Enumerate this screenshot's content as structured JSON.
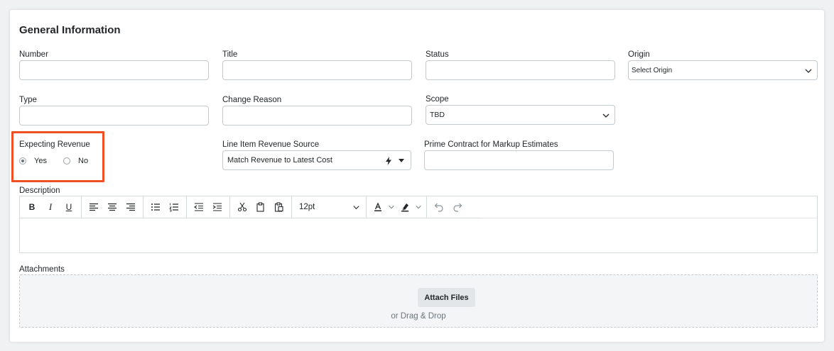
{
  "section": {
    "title": "General Information"
  },
  "fields": {
    "number": {
      "label": "Number",
      "value": ""
    },
    "title": {
      "label": "Title",
      "value": ""
    },
    "status": {
      "label": "Status",
      "value": ""
    },
    "origin": {
      "label": "Origin",
      "value": "Select Origin"
    },
    "type": {
      "label": "Type",
      "value": ""
    },
    "change_reason": {
      "label": "Change Reason",
      "value": ""
    },
    "scope": {
      "label": "Scope",
      "value": "TBD"
    },
    "expecting_revenue": {
      "label": "Expecting Revenue",
      "options": [
        {
          "label": "Yes",
          "checked": true
        },
        {
          "label": "No",
          "checked": false
        }
      ]
    },
    "line_item_revenue_source": {
      "label": "Line Item Revenue Source",
      "value": "Match Revenue to Latest Cost"
    },
    "prime_contract": {
      "label": "Prime Contract for Markup Estimates",
      "value": ""
    },
    "description": {
      "label": "Description",
      "value": ""
    },
    "attachments": {
      "label": "Attachments",
      "button": "Attach Files",
      "hint": "or Drag & Drop"
    }
  },
  "editor_toolbar": {
    "bold": "B",
    "italic": "I",
    "underline": "U",
    "font_size": "12pt",
    "icons": [
      "bold-icon",
      "italic-icon",
      "underline-icon",
      "align-left-icon",
      "align-center-icon",
      "align-right-icon",
      "bullet-list-icon",
      "numbered-list-icon",
      "outdent-icon",
      "indent-icon",
      "cut-icon",
      "copy-icon",
      "paste-icon",
      "text-color-icon",
      "highlight-icon",
      "undo-icon",
      "redo-icon"
    ]
  },
  "colors": {
    "highlight_border": "#f04e23",
    "border": "#c4cacd",
    "text": "#232729"
  }
}
